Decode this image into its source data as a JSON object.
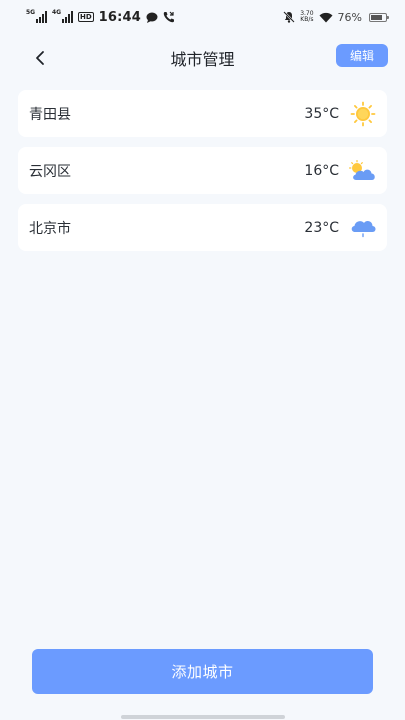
{
  "status_bar": {
    "sim1_tag": "5G",
    "sim2_tag": "4G",
    "hd_label": "HD",
    "time": "16:44",
    "net_speed_value": "3.70",
    "net_speed_unit": "KB/s",
    "battery_percent": "76%",
    "battery_level": 0.76
  },
  "header": {
    "back_icon": "chevron-left-icon",
    "title": "城市管理",
    "edit_label": "编辑"
  },
  "cities": [
    {
      "name": "青田县",
      "temp": "35°C",
      "weather_icon": "sun-icon"
    },
    {
      "name": "云冈区",
      "temp": "16°C",
      "weather_icon": "partly-cloudy-icon"
    },
    {
      "name": "北京市",
      "temp": "23°C",
      "weather_icon": "light-rain-cloud-icon"
    }
  ],
  "bottom": {
    "add_city_label": "添加城市"
  },
  "colors": {
    "accent": "#6b9bff",
    "background": "#f5f8fc",
    "card": "#ffffff",
    "sun": "#ffc83d",
    "cloud": "#6a9cf5"
  }
}
